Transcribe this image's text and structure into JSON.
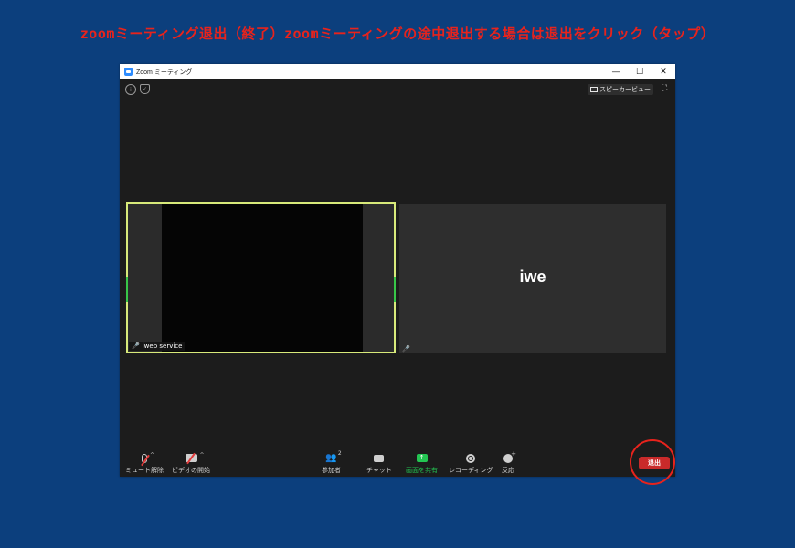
{
  "caption": "zoomミーティング退出（終了）zoomミーティングの途中退出する場合は退出をクリック（タップ）",
  "window": {
    "title": "Zoom ミーティング",
    "controls": {
      "minimize": "—",
      "maximize": "☐",
      "close": "✕"
    }
  },
  "top_bar": {
    "info_icon": "i",
    "speaker_view_label": "スピーカービュー"
  },
  "tiles": {
    "left_name": "iweb service",
    "right_name": "iwe"
  },
  "toolbar": {
    "mute_label": "ミュート解除",
    "video_label": "ビデオの開始",
    "participants_label": "参加者",
    "participants_count": "2",
    "chat_label": "チャット",
    "share_label": "画面を共有",
    "record_label": "レコーディング",
    "reactions_label": "反応",
    "leave_label": "退出"
  },
  "colors": {
    "page_background": "#0c3f7d",
    "caption_red": "#e8231c",
    "share_green": "#23c552",
    "leave_red": "#c92a2a",
    "active_speaker_border": "#d8ea7a"
  }
}
